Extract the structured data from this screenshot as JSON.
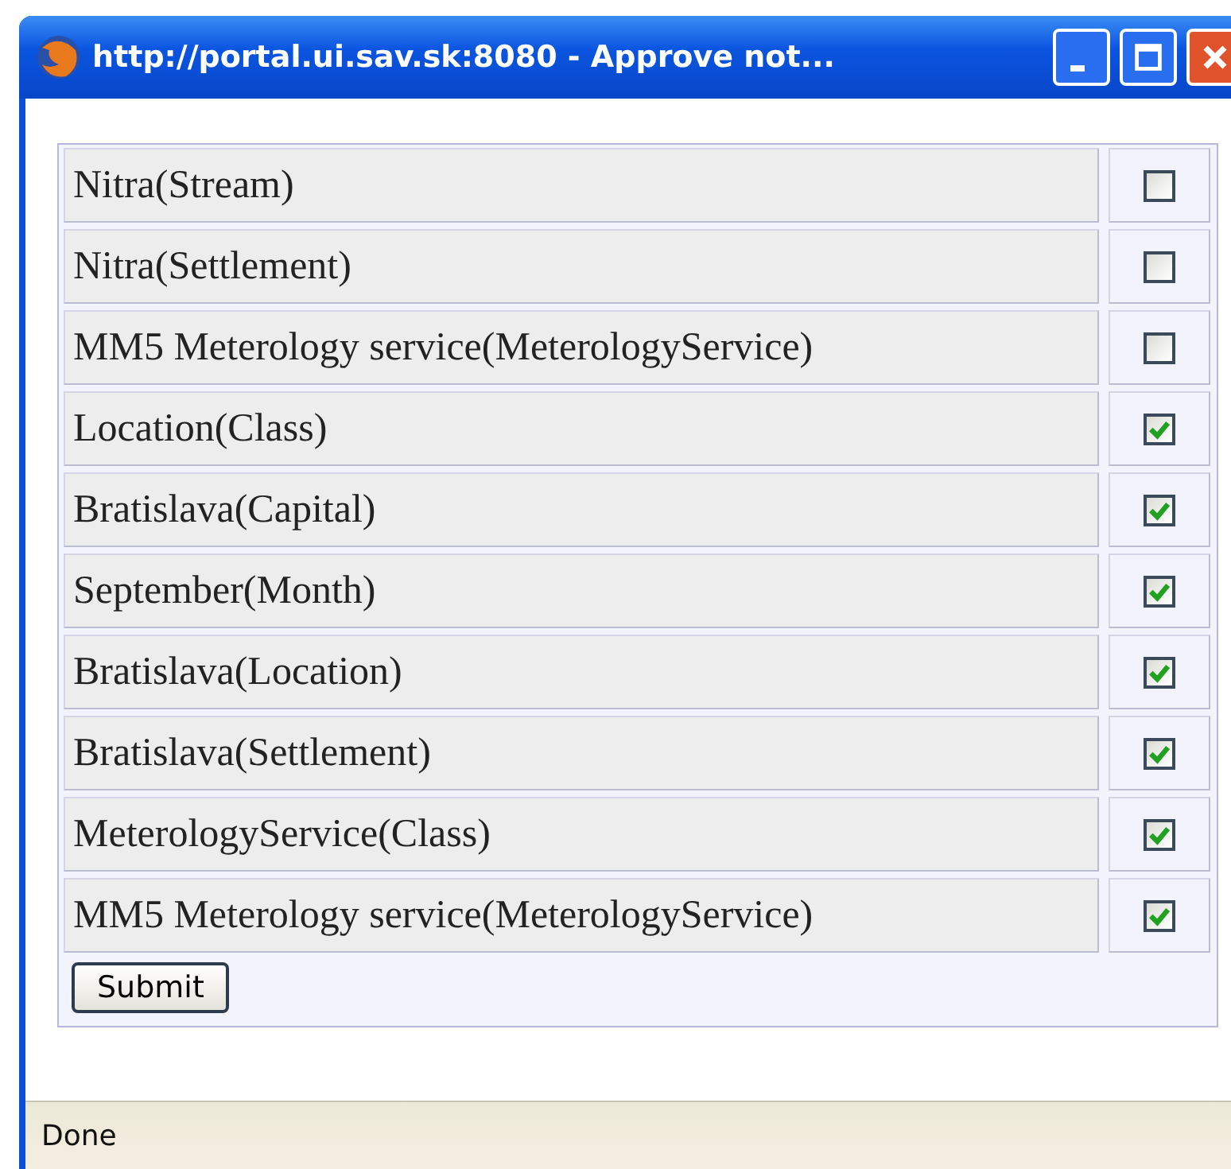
{
  "window": {
    "title": "http://portal.ui.sav.sk:8080 - Approve not..."
  },
  "rows": [
    {
      "label": "Nitra(Stream)",
      "checked": false
    },
    {
      "label": "Nitra(Settlement)",
      "checked": false
    },
    {
      "label": "MM5 Meterology service(MeterologyService)",
      "checked": false
    },
    {
      "label": "Location(Class)",
      "checked": true
    },
    {
      "label": "Bratislava(Capital)",
      "checked": true
    },
    {
      "label": "September(Month)",
      "checked": true
    },
    {
      "label": "Bratislava(Location)",
      "checked": true
    },
    {
      "label": "Bratislava(Settlement)",
      "checked": true
    },
    {
      "label": "MeterologyService(Class)",
      "checked": true
    },
    {
      "label": "MM5 Meterology service(MeterologyService)",
      "checked": true
    }
  ],
  "submit": "Submit",
  "status_bar": "Done"
}
